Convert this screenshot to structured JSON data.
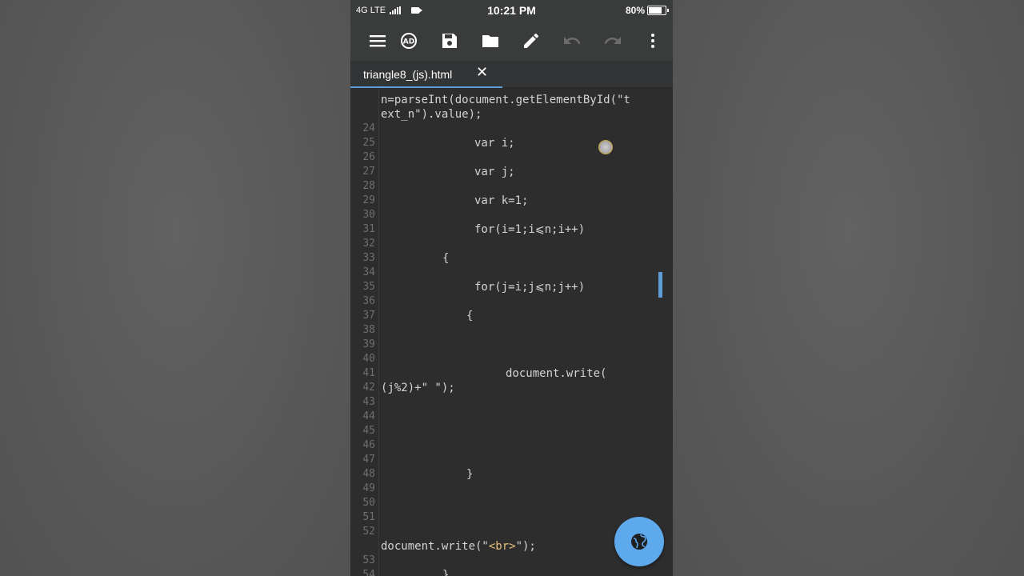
{
  "status_bar": {
    "network": "4G LTE",
    "time": "10:21 PM",
    "battery": "80%",
    "battery_level": 0.8
  },
  "toolbar": {
    "icons": [
      "menu-icon",
      "ad-icon",
      "save-icon",
      "folder-icon",
      "edit-icon",
      "undo-icon",
      "redo-icon",
      "more-vert-icon"
    ]
  },
  "tab": {
    "label": "triangle8_(js).html",
    "close": "✕"
  },
  "editor": {
    "gutter": [
      "24",
      "25",
      "26",
      "27",
      "28",
      "29",
      "30",
      "31",
      "32",
      "33",
      "34",
      "35",
      "36",
      "37",
      "38",
      "39",
      "40",
      "41",
      "42",
      "43",
      "44",
      "45",
      "46",
      "47",
      "48",
      "49",
      "50",
      "51",
      "52",
      "53",
      "54"
    ],
    "lines": [
      "n=parseInt(document.getElementById(\"t",
      "ext_n\").value);",
      "var i;",
      "var j;",
      "var k=1;",
      "for(i=1;i⩽n;i++)",
      "{",
      "for(j=i;j⩽n;j++)",
      "{",
      "document.write(",
      "(j%2)+\" \");",
      "}",
      "document.write(\"",
      "<br>",
      "\");",
      "}"
    ]
  },
  "fab": {
    "icon": "globe-icon"
  },
  "colors": {
    "accent": "#5d9ed6",
    "fab": "#5ea8ec",
    "editor_bg": "#2d2d2d",
    "toolbar_bg": "#3a3b3b"
  }
}
